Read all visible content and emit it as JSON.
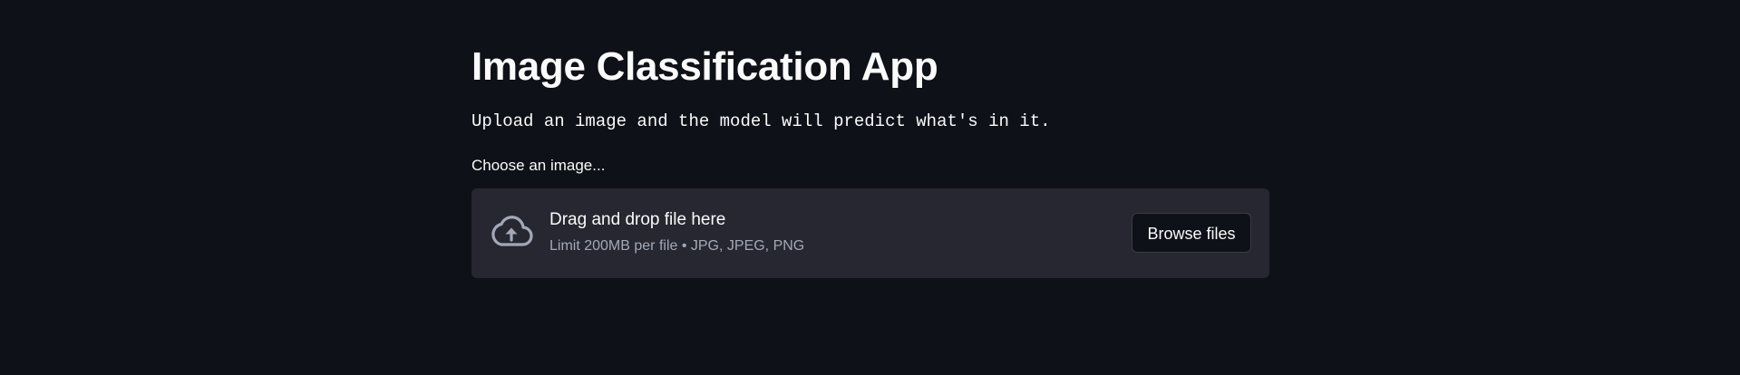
{
  "app": {
    "title": "Image Classification App",
    "description": "Upload an image and the model will predict what's in it."
  },
  "uploader": {
    "label": "Choose an image...",
    "drop_title": "Drag and drop file here",
    "limit_text": "Limit 200MB per file • JPG, JPEG, PNG",
    "browse_label": "Browse files",
    "icon": "cloud-upload-icon"
  },
  "colors": {
    "background": "#0e1117",
    "dropzone": "#262730",
    "text": "#fafafa",
    "muted_text": "#a3a8b8"
  }
}
